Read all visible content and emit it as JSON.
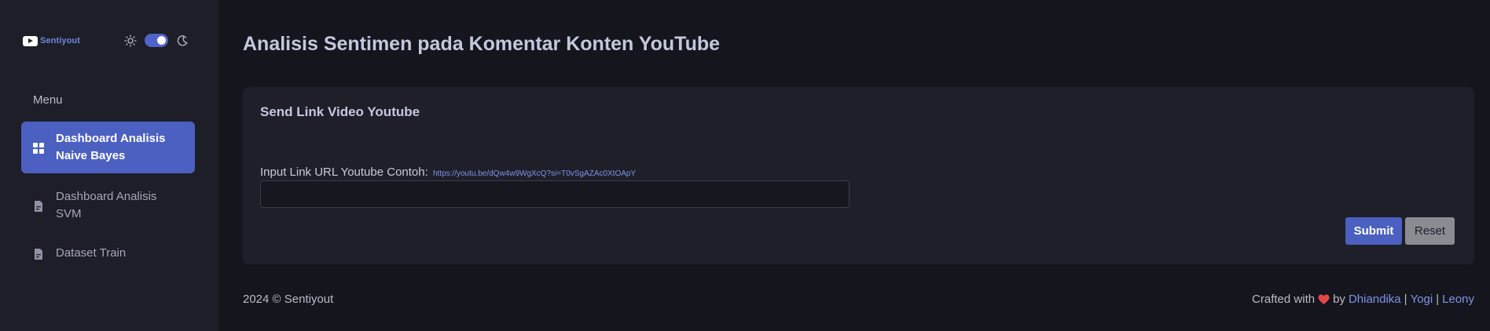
{
  "brand": {
    "name": "Sentiyout",
    "logo_icon": "youtube-logo-icon"
  },
  "theme": {
    "light_icon": "sun-icon",
    "dark_icon": "moon-icon",
    "dark_mode": true
  },
  "sidebar": {
    "menu_title": "Menu",
    "items": [
      {
        "label": "Dashboard Analisis Naive Bayes",
        "icon": "grid-icon",
        "active": true
      },
      {
        "label": "Dashboard Analisis SVM",
        "icon": "document-icon",
        "active": false
      },
      {
        "label": "Dataset Train",
        "icon": "document-icon",
        "active": false
      }
    ]
  },
  "main": {
    "page_title": "Analisis Sentimen pada Komentar Konten YouTube",
    "card": {
      "title": "Send Link Video Youtube",
      "field_label": "Input Link URL Youtube Contoh:",
      "field_example": "https://youtu.be/dQw4w9WgXcQ?si=T0vSgAZAc0XtOApY",
      "input_value": "",
      "submit_label": "Submit",
      "reset_label": "Reset"
    }
  },
  "footer": {
    "copyright": "2024 © Sentiyout",
    "crafted_prefix": "Crafted with",
    "crafted_by": "by",
    "authors": [
      "Dhiandika",
      "Yogi",
      "Leony"
    ],
    "separator": "|"
  },
  "colors": {
    "accent": "#4b60c0",
    "link": "#7f94e8",
    "background": "#15151d",
    "sidebar": "#1e1e28",
    "card": "#1f1f2a",
    "heart": "#e04848"
  }
}
